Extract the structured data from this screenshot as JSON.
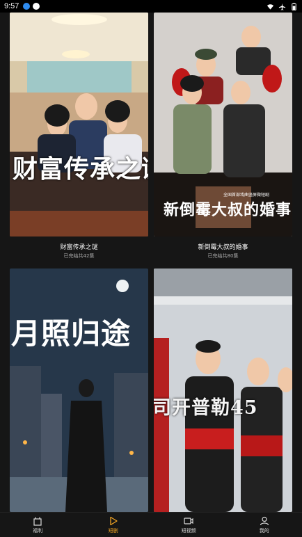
{
  "status_bar": {
    "time": "9:57"
  },
  "feed": {
    "cards": [
      {
        "title": "财富传承之谜",
        "subtitle": "已完结共42集",
        "poster_text": "财富传承之谜"
      },
      {
        "title": "新倒霉大叔的婚事",
        "subtitle": "已完结共80集",
        "poster_text": "新倒霉大叔的婚事",
        "poster_tagline": "全国首部戏曲竖屏微短剧"
      },
      {
        "title": "",
        "subtitle": "",
        "poster_text": "月照归途"
      },
      {
        "title": "",
        "subtitle": "",
        "poster_text": "司开普勒45"
      }
    ]
  },
  "bottom_nav": {
    "items": [
      {
        "label": "福利",
        "icon": "gift-icon",
        "active": false
      },
      {
        "label": "短剧",
        "icon": "play-icon",
        "active": true
      },
      {
        "label": "短视频",
        "icon": "video-icon",
        "active": false
      },
      {
        "label": "我的",
        "icon": "user-icon",
        "active": false
      }
    ]
  },
  "colors": {
    "accent": "#f5a623",
    "background": "#161616"
  }
}
